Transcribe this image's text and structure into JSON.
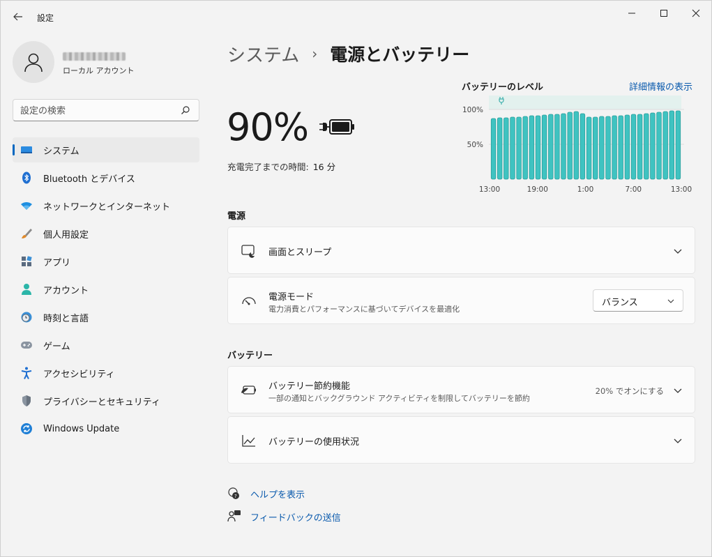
{
  "window": {
    "title": "設定",
    "back_icon": "back-arrow-icon",
    "controls": [
      "minimize-icon",
      "maximize-icon",
      "close-icon"
    ]
  },
  "user": {
    "account_type": "ローカル アカウント"
  },
  "search": {
    "placeholder": "設定の検索"
  },
  "sidebar": {
    "items": [
      {
        "label": "システム",
        "icon": "system-icon",
        "active": true
      },
      {
        "label": "Bluetooth とデバイス",
        "icon": "bluetooth-icon",
        "active": false
      },
      {
        "label": "ネットワークとインターネット",
        "icon": "wifi-icon",
        "active": false
      },
      {
        "label": "個人用設定",
        "icon": "brush-icon",
        "active": false
      },
      {
        "label": "アプリ",
        "icon": "apps-icon",
        "active": false
      },
      {
        "label": "アカウント",
        "icon": "account-icon",
        "active": false
      },
      {
        "label": "時刻と言語",
        "icon": "clock-globe-icon",
        "active": false
      },
      {
        "label": "ゲーム",
        "icon": "gamepad-icon",
        "active": false
      },
      {
        "label": "アクセシビリティ",
        "icon": "accessibility-icon",
        "active": false
      },
      {
        "label": "プライバシーとセキュリティ",
        "icon": "shield-icon",
        "active": false
      },
      {
        "label": "Windows Update",
        "icon": "update-icon",
        "active": false
      }
    ]
  },
  "header": {
    "parent": "システム",
    "separator": "›",
    "current": "電源とバッテリー"
  },
  "battery": {
    "percent": "90%",
    "charge_label": "充電完了までの時間:",
    "charge_value": "16 分"
  },
  "level": {
    "title": "バッテリーのレベル",
    "link": "詳細情報の表示"
  },
  "chart_data": {
    "type": "bar",
    "y_ticks": [
      "100%",
      "50%"
    ],
    "x_ticks": [
      "13:00",
      "19:00",
      "1:00",
      "7:00",
      "13:00"
    ],
    "ylim": [
      0,
      100
    ],
    "values": [
      87,
      88,
      88,
      89,
      89,
      90,
      91,
      91,
      92,
      93,
      93,
      94,
      96,
      97,
      94,
      89,
      89,
      90,
      90,
      91,
      91,
      92,
      93,
      93,
      94,
      95,
      96,
      97,
      98,
      98
    ],
    "color": "#3fc3c1"
  },
  "power_section": {
    "label": "電源",
    "screen_sleep": {
      "title": "画面とスリープ",
      "icon": "screen-sleep-icon"
    },
    "power_mode": {
      "title": "電源モード",
      "subtitle": "電力消費とパフォーマンスに基づいてデバイスを最適化",
      "icon": "gauge-icon",
      "selected": "バランス"
    }
  },
  "battery_section": {
    "label": "バッテリー",
    "saver": {
      "title": "バッテリー節約機能",
      "subtitle": "一部の通知とバックグラウンド アクティビティを制限してバッテリーを節約",
      "status": "20% でオンにする",
      "icon": "battery-saver-icon"
    },
    "usage": {
      "title": "バッテリーの使用状況",
      "icon": "usage-chart-icon"
    }
  },
  "footer": {
    "help": "ヘルプを表示",
    "feedback": "フィードバックの送信"
  }
}
